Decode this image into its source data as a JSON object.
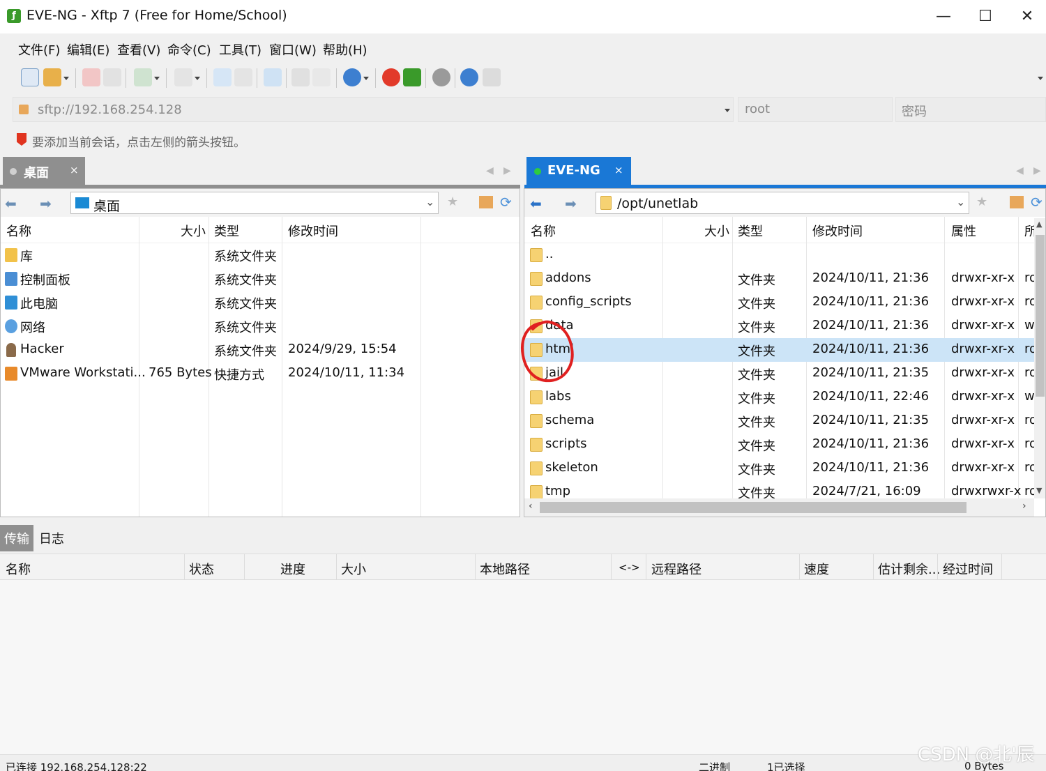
{
  "window": {
    "title": "EVE-NG - Xftp 7 (Free for Home/School)",
    "minimize": "—",
    "maximize": "☐",
    "close": "✕"
  },
  "menu": [
    "文件(F)",
    "编辑(E)",
    "查看(V)",
    "命令(C)",
    "工具(T)",
    "窗口(W)",
    "帮助(H)"
  ],
  "address": {
    "url": "sftp://192.168.254.128",
    "user_placeholder": "root",
    "password_placeholder": "密码"
  },
  "hint": "要添加当前会话，点击左侧的箭头按钮。",
  "left_tab": {
    "label": "桌面",
    "close": "×"
  },
  "right_tab": {
    "label": "EVE-NG",
    "close": "×"
  },
  "left_pane": {
    "path": "桌面",
    "columns": [
      "名称",
      "大小",
      "类型",
      "修改时间"
    ],
    "rows": [
      {
        "name": "库",
        "size": "",
        "type": "系统文件夹",
        "modified": "",
        "icon": "library-icon"
      },
      {
        "name": "控制面板",
        "size": "",
        "type": "系统文件夹",
        "modified": "",
        "icon": "control-panel-icon"
      },
      {
        "name": "此电脑",
        "size": "",
        "type": "系统文件夹",
        "modified": "",
        "icon": "computer-icon"
      },
      {
        "name": "网络",
        "size": "",
        "type": "系统文件夹",
        "modified": "",
        "icon": "network-icon"
      },
      {
        "name": "Hacker",
        "size": "",
        "type": "系统文件夹",
        "modified": "2024/9/29, 15:54",
        "icon": "user-icon"
      },
      {
        "name": "VMware Workstati...",
        "size": "765 Bytes",
        "type": "快捷方式",
        "modified": "2024/10/11, 11:34",
        "icon": "vmware-icon"
      }
    ]
  },
  "right_pane": {
    "path": "/opt/unetlab",
    "columns": [
      "名称",
      "大小",
      "类型",
      "修改时间",
      "属性",
      "所"
    ],
    "rows": [
      {
        "name": "..",
        "type": "",
        "modified": "",
        "attr": "",
        "owner": ""
      },
      {
        "name": "addons",
        "type": "文件夹",
        "modified": "2024/10/11, 21:36",
        "attr": "drwxr-xr-x",
        "owner": "ro"
      },
      {
        "name": "config_scripts",
        "type": "文件夹",
        "modified": "2024/10/11, 21:36",
        "attr": "drwxr-xr-x",
        "owner": "ro"
      },
      {
        "name": "data",
        "type": "文件夹",
        "modified": "2024/10/11, 21:36",
        "attr": "drwxr-xr-x",
        "owner": "w"
      },
      {
        "name": "html",
        "type": "文件夹",
        "modified": "2024/10/11, 21:36",
        "attr": "drwxr-xr-x",
        "owner": "ro"
      },
      {
        "name": "jail",
        "type": "文件夹",
        "modified": "2024/10/11, 21:35",
        "attr": "drwxr-xr-x",
        "owner": "ro"
      },
      {
        "name": "labs",
        "type": "文件夹",
        "modified": "2024/10/11, 22:46",
        "attr": "drwxr-xr-x",
        "owner": "w"
      },
      {
        "name": "schema",
        "type": "文件夹",
        "modified": "2024/10/11, 21:35",
        "attr": "drwxr-xr-x",
        "owner": "ro"
      },
      {
        "name": "scripts",
        "type": "文件夹",
        "modified": "2024/10/11, 21:36",
        "attr": "drwxr-xr-x",
        "owner": "ro"
      },
      {
        "name": "skeleton",
        "type": "文件夹",
        "modified": "2024/10/11, 21:36",
        "attr": "drwxr-xr-x",
        "owner": "ro"
      },
      {
        "name": "tmp",
        "type": "文件夹",
        "modified": "2024/7/21, 16:09",
        "attr": "drwxrwxr-x",
        "owner": "ro"
      }
    ],
    "selected_index": 4
  },
  "bottom": {
    "tabs": [
      "传输",
      "日志"
    ],
    "columns": [
      "名称",
      "状态",
      "进度",
      "大小",
      "本地路径",
      "<->",
      "远程路径",
      "速度",
      "估计剩余...",
      "经过时间"
    ]
  },
  "status": {
    "connection": "已连接 192.168.254.128:22",
    "mode": "二进制",
    "selected": "1已选择",
    "size": "0 Bytes"
  },
  "watermark": "CSDN @北'辰",
  "colors": {
    "accent": "#1a78d6",
    "selection": "#cce4f7",
    "annotation": "#e02020"
  }
}
